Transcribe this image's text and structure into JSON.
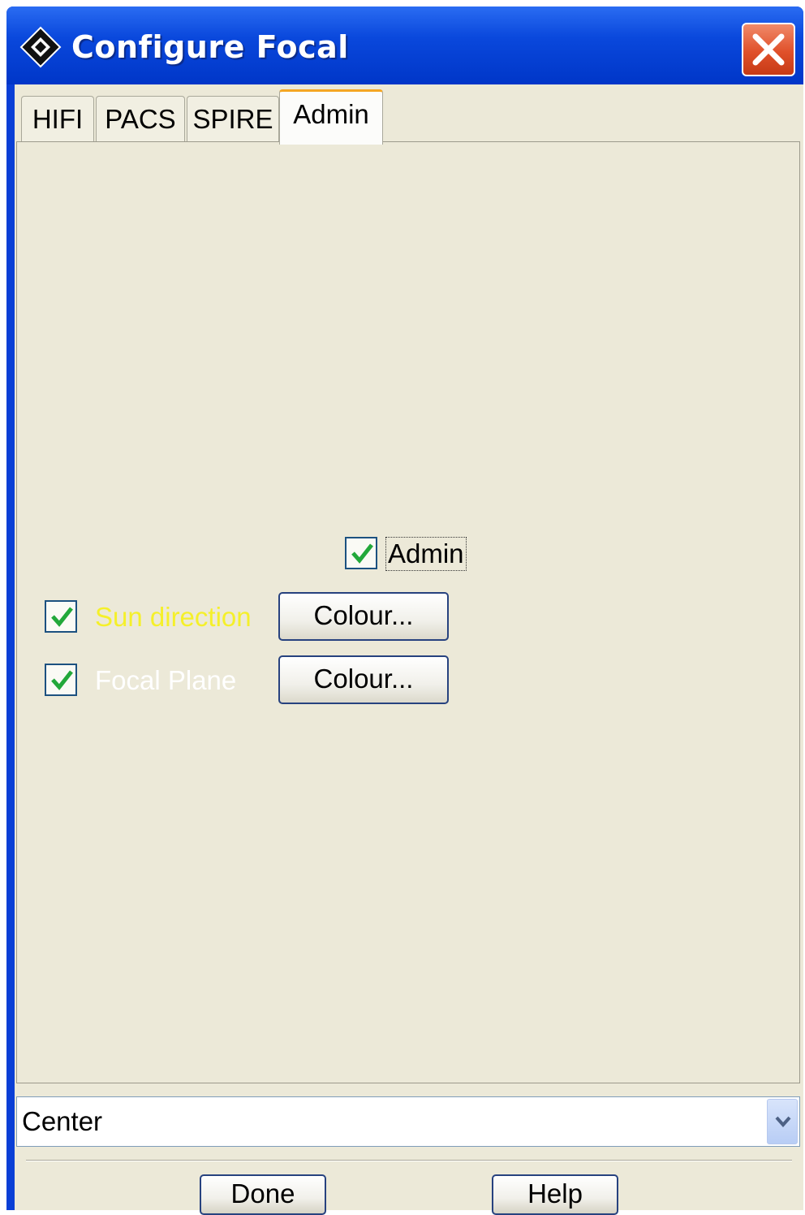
{
  "window": {
    "title": "Configure Focal"
  },
  "tabs": [
    {
      "label": "HIFI"
    },
    {
      "label": "PACS"
    },
    {
      "label": "SPIRE"
    },
    {
      "label": "Admin",
      "active": true
    }
  ],
  "admin_panel": {
    "admin_checkbox": {
      "label": "Admin",
      "checked": true
    },
    "rows": [
      {
        "label": "Sun direction",
        "label_color": "#f5f02a",
        "checked": true,
        "button_label": "Colour..."
      },
      {
        "label": "Focal Plane",
        "label_color": "#ffffff",
        "checked": true,
        "button_label": "Colour..."
      }
    ]
  },
  "position_select": {
    "selected": "Center"
  },
  "footer": {
    "done_label": "Done",
    "help_label": "Help"
  },
  "colors": {
    "titlebar": "#0a48dc",
    "client_background": "#ece9d8",
    "check_mark": "#22a83a",
    "close_button": "#e0502a",
    "active_tab_highlight": "#f5a623"
  },
  "icons": {
    "app": "diamond-app-icon",
    "close": "close-x-icon",
    "check": "checkmark-icon",
    "dropdown": "chevron-down-icon"
  }
}
